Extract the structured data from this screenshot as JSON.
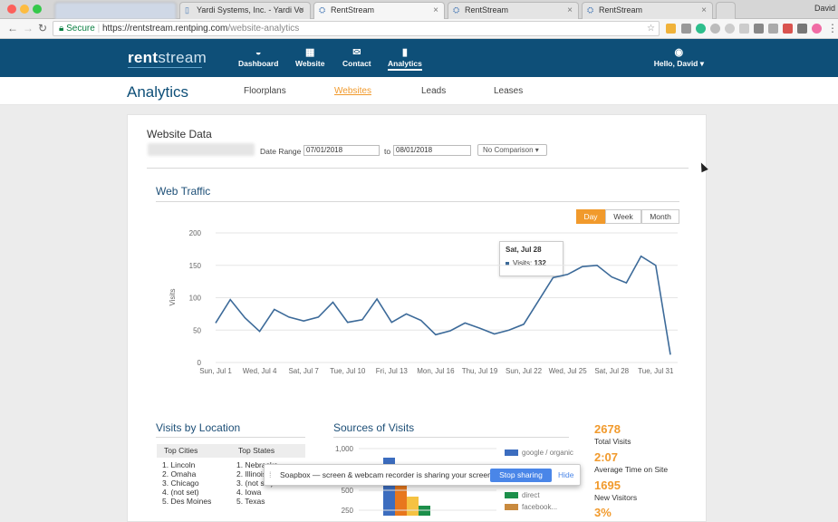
{
  "browser": {
    "tabs": [
      {
        "label": "Yardi Systems, Inc. - Yardi Vo",
        "active": false
      },
      {
        "label": "RentStream",
        "active": true
      },
      {
        "label": "RentStream",
        "active": false
      },
      {
        "label": "RentStream",
        "active": false
      }
    ],
    "user": "David",
    "secure_label": "Secure",
    "url_host": "https://rentstream.rentping.com",
    "url_path": "/website-analytics"
  },
  "header": {
    "logo_bold": "rent",
    "logo_rest": "stream",
    "nav": [
      {
        "label": "Dashboard",
        "icon": "dashboard-icon",
        "glyph": "◒"
      },
      {
        "label": "Website",
        "icon": "website-icon",
        "glyph": "▦"
      },
      {
        "label": "Contact",
        "icon": "contact-icon",
        "glyph": "✉"
      },
      {
        "label": "Analytics",
        "icon": "analytics-icon",
        "glyph": "▮"
      }
    ],
    "active_nav": "Analytics",
    "greeting": "Hello, David ▾"
  },
  "subnav": {
    "title": "Analytics",
    "tabs": [
      "Floorplans",
      "Websites",
      "Leads",
      "Leases"
    ],
    "active_tab": "Websites"
  },
  "website_data": {
    "title": "Website Data",
    "date_range_label": "Date Range",
    "start_date": "07/01/2018",
    "to_label": "to",
    "end_date": "08/01/2018",
    "comparison": "No Comparison ▾"
  },
  "web_traffic": {
    "title": "Web Traffic",
    "periods": [
      "Day",
      "Week",
      "Month"
    ],
    "active_period": "Day",
    "tooltip": {
      "date": "Sat, Jul 28",
      "label": "Visits:",
      "value": "132"
    }
  },
  "chart_data": {
    "type": "line",
    "ylabel": "Visits",
    "ylim": [
      0,
      200
    ],
    "yticks": [
      "0",
      "50",
      "100",
      "150",
      "200"
    ],
    "x_tick_labels": [
      "Sun, Jul 1",
      "Wed, Jul 4",
      "Sat, Jul 7",
      "Tue, Jul 10",
      "Fri, Jul 13",
      "Mon, Jul 16",
      "Thu, Jul 19",
      "Sun, Jul 22",
      "Wed, Jul 25",
      "Sat, Jul 28",
      "Tue, Jul 31"
    ],
    "x": [
      "Jul 1",
      "Jul 2",
      "Jul 3",
      "Jul 4",
      "Jul 5",
      "Jul 6",
      "Jul 7",
      "Jul 8",
      "Jul 9",
      "Jul 10",
      "Jul 11",
      "Jul 12",
      "Jul 13",
      "Jul 14",
      "Jul 15",
      "Jul 16",
      "Jul 17",
      "Jul 18",
      "Jul 19",
      "Jul 20",
      "Jul 21",
      "Jul 22",
      "Jul 23",
      "Jul 24",
      "Jul 25",
      "Jul 26",
      "Jul 27",
      "Jul 28",
      "Jul 29",
      "Jul 30",
      "Jul 31",
      "Aug 1"
    ],
    "series": [
      {
        "values": [
          61,
          97,
          69,
          48,
          82,
          70,
          64,
          70,
          93,
          62,
          66,
          98,
          62,
          75,
          65,
          43,
          49,
          61,
          53,
          44,
          50,
          59,
          95,
          131,
          136,
          148,
          150,
          132,
          123,
          164,
          150,
          12
        ]
      }
    ],
    "color": "#3c6a99",
    "grid": true
  },
  "location": {
    "title": "Visits by Location",
    "cities_header": "Top Cities",
    "states_header": "Top States",
    "cities": [
      "1. Lincoln",
      "2. Omaha",
      "3. Chicago",
      "4. (not set)",
      "5. Des Moines"
    ],
    "states": [
      "1. Nebraska",
      "2. Illinois",
      "3. (not set)",
      "4. Iowa",
      "5. Texas"
    ]
  },
  "sources": {
    "title": "Sources of Visits",
    "chart_data": {
      "type": "bar",
      "yticks": [
        "250",
        "500",
        "1,000"
      ],
      "legend": [
        {
          "name": "google / organic",
          "color": "#3c6dbf"
        },
        {
          "name": "direct",
          "color": "#1c8f4a"
        },
        {
          "name": "facebook...",
          "color": "#c98a3e"
        }
      ],
      "bar_colors": [
        "#3c6dbf",
        "#e8771d",
        "#f5c242",
        "#1c8f4a"
      ]
    }
  },
  "stats": [
    {
      "value": "2678",
      "label": "Total Visits"
    },
    {
      "value": "2:07",
      "label": "Average Time on Site"
    },
    {
      "value": "1695",
      "label": "New Visitors"
    },
    {
      "value": "3%",
      "label": ""
    }
  ],
  "soapbox": {
    "message": "Soapbox — screen & webcam recorder is sharing your screen.",
    "stop_label": "Stop sharing",
    "hide_label": "Hide"
  }
}
